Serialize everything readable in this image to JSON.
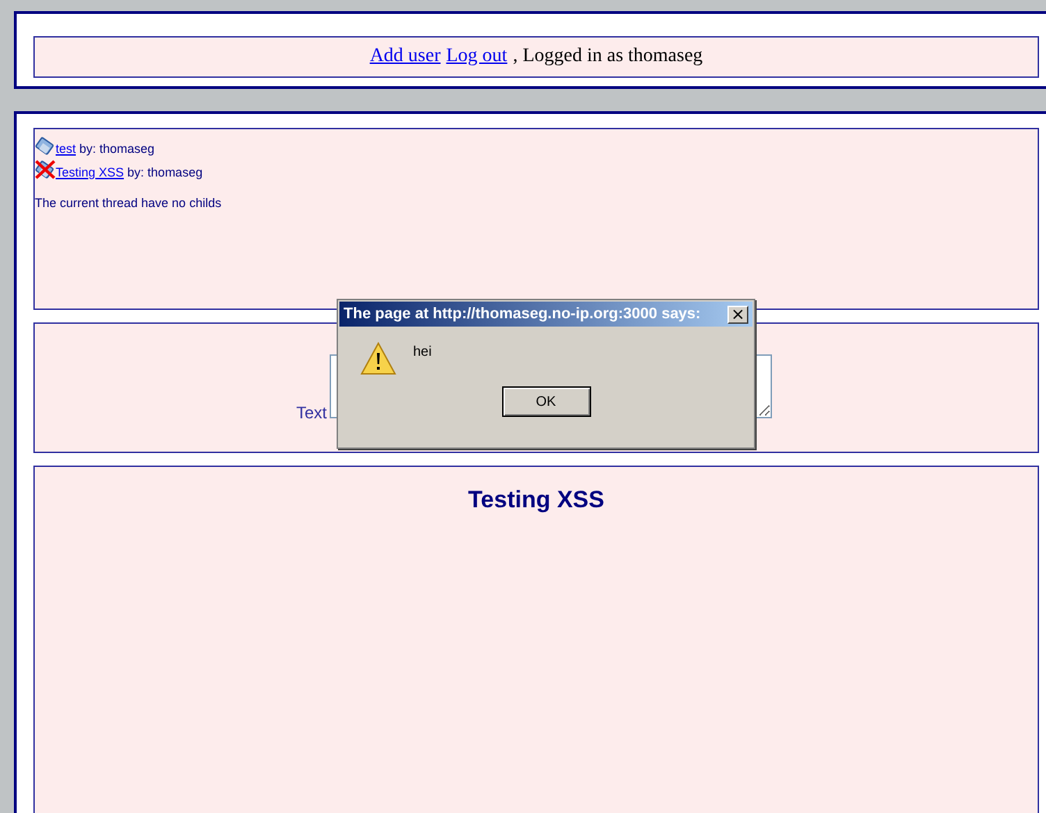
{
  "header": {
    "links": [
      "Add user",
      "Log out"
    ],
    "status": ", Logged in as thomaseg"
  },
  "threads": [
    {
      "kind": "ok",
      "title": "test",
      "byline": "by: thomaseg"
    },
    {
      "kind": "deleted",
      "title": "Testing XSS",
      "byline": "by: thomaseg"
    }
  ],
  "thread_note": "The current thread have no childs",
  "form": {
    "label": "Text"
  },
  "post": {
    "title": "Testing XSS"
  },
  "dialog": {
    "title": "The page at http://thomaseg.no-ip.org:3000 says:",
    "close": "×",
    "message": "hei",
    "button": "OK"
  }
}
